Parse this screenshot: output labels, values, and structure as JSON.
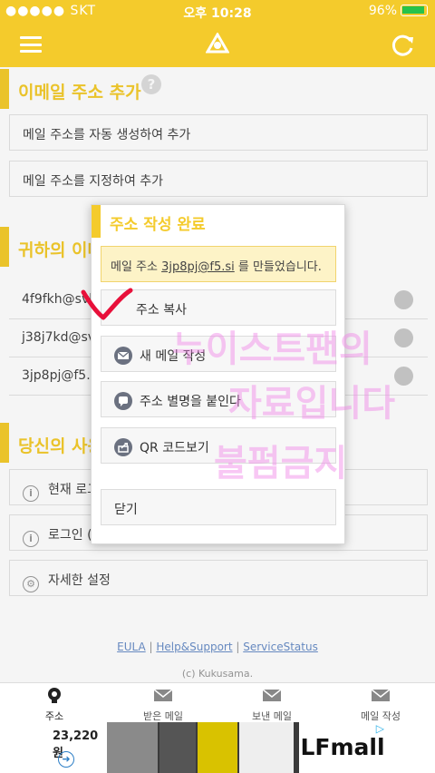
{
  "status_bar": {
    "carrier": "●●●●● SKT",
    "time": "오후 10:28",
    "battery": "96%"
  },
  "header": {
    "menu_icon": "hamburger-icon",
    "logo_icon": "logo-icon",
    "refresh_icon": "refresh-icon"
  },
  "add_section": {
    "title": "이메일 주소 추가",
    "auto_generate": "메일 주소를 자동 생성하여 추가",
    "specify": "메일 주소를 지정하여 추가"
  },
  "address_section": {
    "title": "귀하의 이메",
    "addresses": [
      "4f9fkh@svk",
      "j38j7kd@sv",
      "3jp8pj@f5.s"
    ]
  },
  "usage_section": {
    "title": "당신의 사용",
    "current_login": "현재 로그",
    "login": "로그인 (복",
    "settings": "자세한 설정"
  },
  "footer": {
    "eula": "EULA",
    "help": "Help&Support",
    "status": "ServiceStatus",
    "sep": "|",
    "copyright": "(c) Kukusama."
  },
  "tabs": [
    {
      "label": "주소",
      "icon": "address-icon"
    },
    {
      "label": "받은 메일",
      "icon": "envelope-icon"
    },
    {
      "label": "보낸 메일",
      "icon": "envelope-icon"
    },
    {
      "label": "메일 작성",
      "icon": "envelope-icon"
    }
  ],
  "ad": {
    "price": "23,220원",
    "brand": "LFmall"
  },
  "dialog": {
    "title": "주소 작성 완료",
    "notice_prefix": "메일 주소 ",
    "notice_address": "3jp8pj@f5.si",
    "notice_suffix": " 를 만들었습니다.",
    "copy": "주소 복사",
    "compose": "새 메일 작성",
    "alias": "주소 별명을 붙인다",
    "qr": "QR 코드보기",
    "close": "닫기"
  },
  "watermark": {
    "line1": "누이스트팬의",
    "line2": "자료입니다",
    "line3": "불펌금지"
  },
  "colors": {
    "accent": "#f4cb2c",
    "watermark": "#f082e6",
    "annotation": "#e8103a"
  }
}
